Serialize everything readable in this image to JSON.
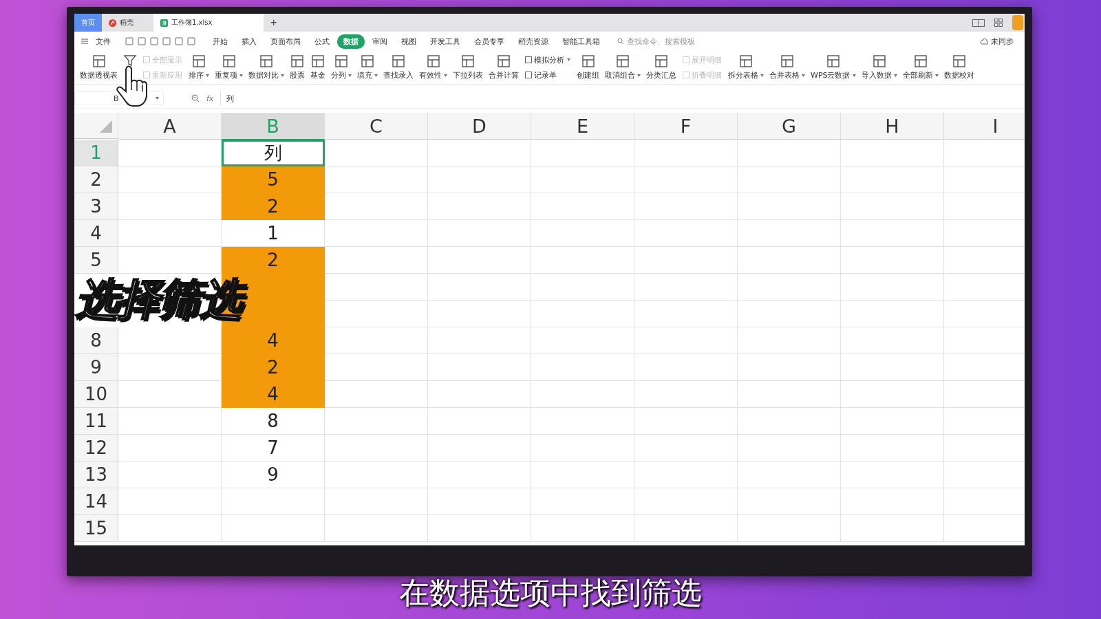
{
  "tabs": [
    {
      "label": "首页",
      "kind": "home",
      "selected": false
    },
    {
      "label": "稻壳",
      "kind": "docer",
      "selected": false
    },
    {
      "label": "工作簿1.xlsx",
      "kind": "sheet",
      "selected": true
    }
  ],
  "new_tab": "+",
  "menu": {
    "file": "文件",
    "items": [
      {
        "label": "开始",
        "selected": false
      },
      {
        "label": "插入",
        "selected": false
      },
      {
        "label": "页面布局",
        "selected": false
      },
      {
        "label": "公式",
        "selected": false
      },
      {
        "label": "数据",
        "selected": true
      },
      {
        "label": "审阅",
        "selected": false
      },
      {
        "label": "视图",
        "selected": false
      },
      {
        "label": "开发工具",
        "selected": false
      },
      {
        "label": "会员专享",
        "selected": false
      },
      {
        "label": "稻壳资源",
        "selected": false
      },
      {
        "label": "智能工具箱",
        "selected": false
      }
    ],
    "search": {
      "placeholder": "查找命令、搜索模板"
    },
    "sync": "未同步"
  },
  "ribbon": [
    {
      "kind": "big",
      "label": "数据透视表",
      "dropdown": false
    },
    {
      "kind": "filter"
    },
    {
      "kind": "pair",
      "items": [
        {
          "label": "全部显示",
          "disabled": true,
          "dropdown": false
        },
        {
          "label": "重新应用",
          "disabled": true,
          "dropdown": false
        }
      ]
    },
    {
      "kind": "big",
      "label": "排序",
      "dropdown": true
    },
    {
      "kind": "big",
      "label": "重复项",
      "dropdown": true
    },
    {
      "kind": "big",
      "label": "数据对比",
      "dropdown": true
    },
    {
      "kind": "big",
      "label": "股票",
      "dropdown": false
    },
    {
      "kind": "big",
      "label": "基金",
      "dropdown": false
    },
    {
      "kind": "big",
      "label": "分列",
      "dropdown": true
    },
    {
      "kind": "big",
      "label": "填充",
      "dropdown": true
    },
    {
      "kind": "big",
      "label": "查找录入",
      "dropdown": false
    },
    {
      "kind": "big",
      "label": "有效性",
      "dropdown": true
    },
    {
      "kind": "big",
      "label": "下拉列表",
      "dropdown": false
    },
    {
      "kind": "big",
      "label": "合并计算",
      "dropdown": false
    },
    {
      "kind": "pair",
      "items": [
        {
          "label": "模拟分析",
          "disabled": false,
          "dropdown": true
        },
        {
          "label": "记录单",
          "disabled": false,
          "dropdown": false
        }
      ]
    },
    {
      "kind": "big",
      "label": "创建组",
      "dropdown": false
    },
    {
      "kind": "big",
      "label": "取消组合",
      "dropdown": true
    },
    {
      "kind": "big",
      "label": "分类汇总",
      "dropdown": false
    },
    {
      "kind": "pair",
      "items": [
        {
          "label": "展开明细",
          "disabled": true,
          "dropdown": false
        },
        {
          "label": "折叠明细",
          "disabled": true,
          "dropdown": false
        }
      ]
    },
    {
      "kind": "big",
      "label": "拆分表格",
      "dropdown": true
    },
    {
      "kind": "big",
      "label": "合并表格",
      "dropdown": true
    },
    {
      "kind": "big",
      "label": "WPS云数据",
      "dropdown": true
    },
    {
      "kind": "big",
      "label": "导入数据",
      "dropdown": true
    },
    {
      "kind": "big",
      "label": "全部刷新",
      "dropdown": true
    },
    {
      "kind": "big",
      "label": "数据校对",
      "dropdown": false
    }
  ],
  "formula_bar": {
    "name_box": "B",
    "fx": "fx",
    "value": "列"
  },
  "sheet": {
    "columns": [
      {
        "label": "A",
        "selected": false
      },
      {
        "label": "B",
        "selected": true
      },
      {
        "label": "C",
        "selected": false
      },
      {
        "label": "D",
        "selected": false
      },
      {
        "label": "E",
        "selected": false
      },
      {
        "label": "F",
        "selected": false
      },
      {
        "label": "G",
        "selected": false
      },
      {
        "label": "H",
        "selected": false
      },
      {
        "label": "I",
        "selected": false
      }
    ],
    "rows": [
      {
        "number": "1",
        "value": "列",
        "highlighted": false,
        "selected": true
      },
      {
        "number": "2",
        "value": "5",
        "highlighted": true,
        "selected": false
      },
      {
        "number": "3",
        "value": "2",
        "highlighted": true,
        "selected": false
      },
      {
        "number": "4",
        "value": "1",
        "highlighted": false,
        "selected": false
      },
      {
        "number": "5",
        "value": "2",
        "highlighted": true,
        "selected": false
      },
      {
        "highlighted": true,
        "selected": false
      },
      {
        "highlighted": true,
        "selected": false
      },
      {
        "number": "8",
        "value": "4",
        "highlighted": true,
        "selected": false
      },
      {
        "number": "9",
        "value": "2",
        "highlighted": true,
        "selected": false
      },
      {
        "number": "10",
        "value": "4",
        "highlighted": true,
        "selected": false
      },
      {
        "number": "11",
        "value": "8",
        "highlighted": false,
        "selected": false
      },
      {
        "number": "12",
        "value": "7",
        "highlighted": false,
        "selected": false
      },
      {
        "number": "13",
        "value": "9",
        "highlighted": false,
        "selected": false
      },
      {
        "number": "14",
        "highlighted": false,
        "selected": false
      },
      {
        "number": "15",
        "highlighted": false,
        "selected": false
      }
    ]
  },
  "overlay_title": "选择筛选",
  "caption": "在数据选项中找到筛选"
}
